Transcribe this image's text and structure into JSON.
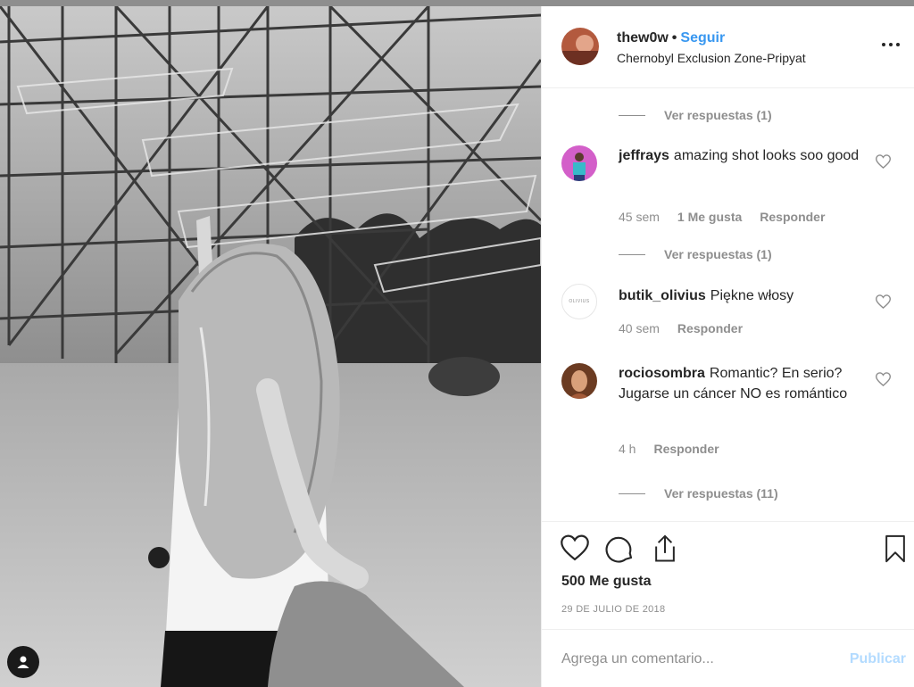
{
  "post": {
    "username": "thew0w",
    "separator": "•",
    "follow_label": "Seguir",
    "location": "Chernobyl Exclusion Zone-Pripyat"
  },
  "comments": [
    {
      "replies_label": "Ver respuestas (1)"
    },
    {
      "username": "jeffrays",
      "text": "amazing shot looks soo good",
      "time": "45 sem",
      "likes": "1 Me gusta",
      "reply_label": "Responder",
      "replies_label": "Ver respuestas (1)"
    },
    {
      "username": "butik_olivius",
      "text": "Piękne włosy",
      "time": "40 sem",
      "reply_label": "Responder",
      "avatar_text": "OLIVIUS"
    },
    {
      "username": "rociosombra",
      "text": "Romantic? En serio? Jugarse un cáncer NO es romántico",
      "time": "4 h",
      "reply_label": "Responder",
      "replies_label": "Ver respuestas (11)"
    }
  ],
  "actions": {
    "icons": [
      "heart-icon",
      "comment-icon",
      "share-icon",
      "bookmark-icon"
    ],
    "likes": "500 Me gusta",
    "date": "29 DE JULIO DE 2018"
  },
  "compose": {
    "placeholder": "Agrega un comentario...",
    "publish_label": "Publicar"
  },
  "colors": {
    "accent": "#3897f0",
    "publish_disabled": "#b3dbff",
    "muted": "#8e8e8e"
  }
}
